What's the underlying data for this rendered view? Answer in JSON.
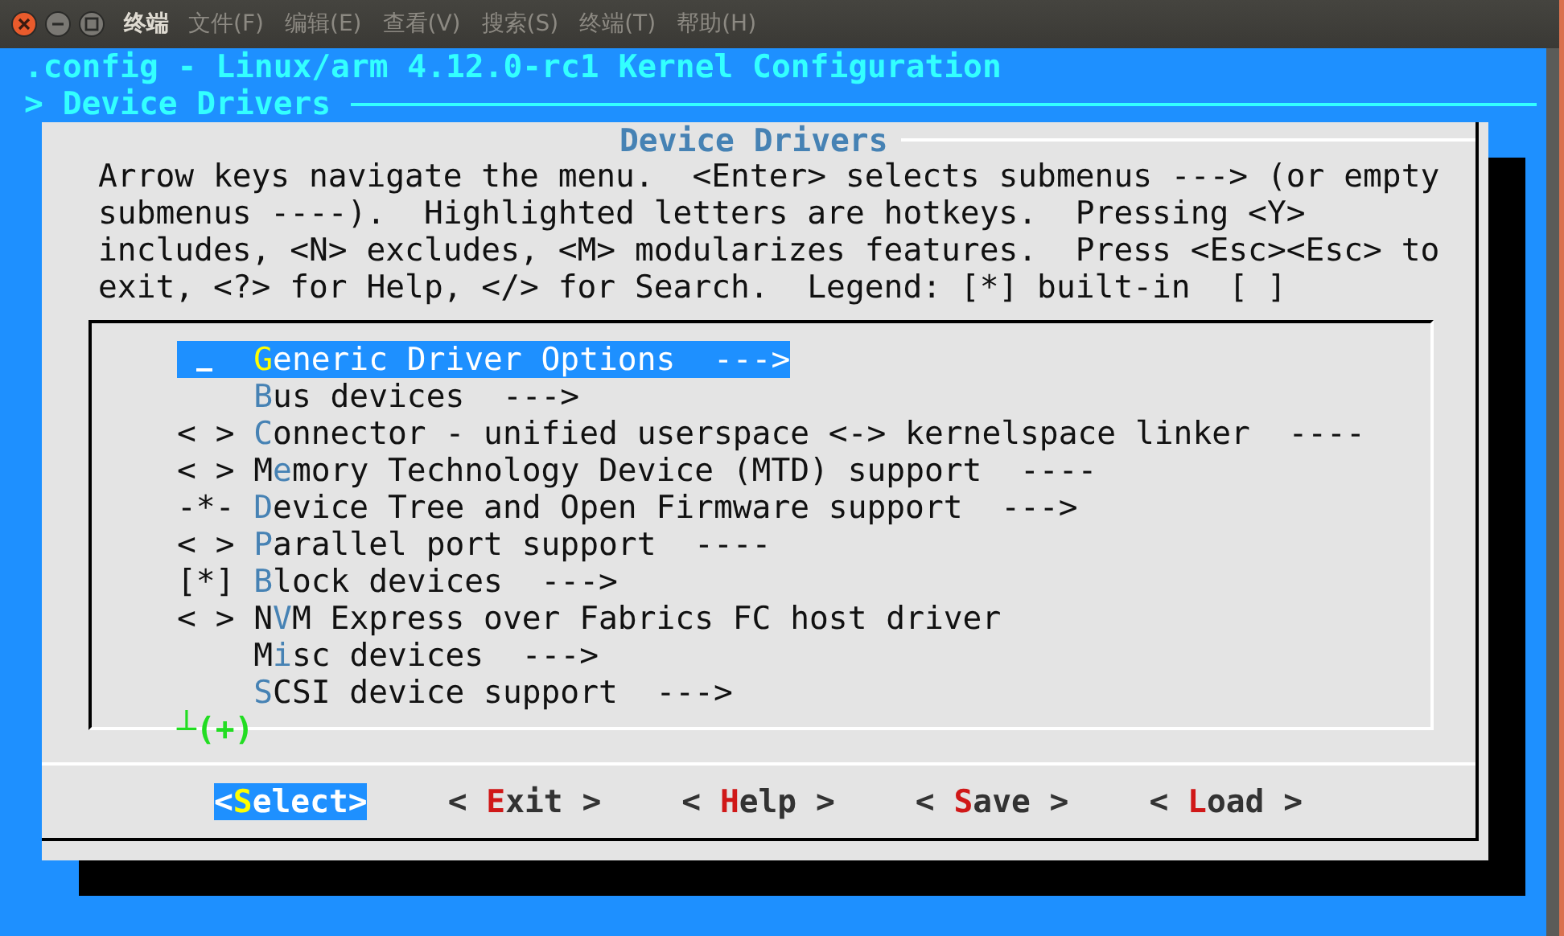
{
  "window": {
    "title": "终端",
    "menu": [
      "文件(F)",
      "编辑(E)",
      "查看(V)",
      "搜索(S)",
      "终端(T)",
      "帮助(H)"
    ]
  },
  "header": {
    "title": ".config - Linux/arm 4.12.0-rc1 Kernel Configuration",
    "breadcrumb": "> Device Drivers"
  },
  "dialog": {
    "title": "Device Drivers",
    "help_lines": [
      "Arrow keys navigate the menu.  <Enter> selects submenus ---> (or empty",
      "submenus ----).  Highlighted letters are hotkeys.  Pressing <Y>",
      "includes, <N> excludes, <M> modularizes features.  Press <Esc><Esc> to",
      "exit, <?> for Help, </> for Search.  Legend: [*] built-in  [ ]"
    ],
    "items": [
      {
        "hotkey": "G",
        "after": "eneric Driver Options  --->",
        "selected": true
      },
      {
        "hotkey": "B",
        "after": "us devices  --->",
        "selected": false
      },
      {
        "prefix": "< >",
        "hotkey": "C",
        "after": "onnector - unified userspace <-> kernelspace linker  ----",
        "selected": false
      },
      {
        "prefix": "< >",
        "before": "M",
        "hotkey": "e",
        "after": "mory Technology Device (MTD) support  ----",
        "selected": false
      },
      {
        "prefix": "-*-",
        "hotkey": "D",
        "after": "evice Tree and Open Firmware support  --->",
        "selected": false
      },
      {
        "prefix": "< >",
        "hotkey": "P",
        "after": "arallel port support  ----",
        "selected": false
      },
      {
        "prefix": "[*]",
        "hotkey": "B",
        "after": "lock devices  --->",
        "selected": false
      },
      {
        "prefix": "< >",
        "before": "N",
        "hotkey": "V",
        "after": "M Express over Fabrics FC host driver",
        "selected": false
      },
      {
        "before": "M",
        "hotkey": "i",
        "after": "sc devices  --->",
        "selected": false
      },
      {
        "hotkey": "S",
        "after": "CSI device support  --->",
        "selected": false
      }
    ],
    "more_indicator": "┴(+)",
    "buttons": [
      {
        "before": "<",
        "hotkey": "S",
        "after": "elect>",
        "selected": true
      },
      {
        "before": "< ",
        "hotkey": "E",
        "after": "xit >",
        "selected": false
      },
      {
        "before": "< ",
        "hotkey": "H",
        "after": "elp >",
        "selected": false
      },
      {
        "before": "< ",
        "hotkey": "S",
        "after": "ave >",
        "selected": false
      },
      {
        "before": "< ",
        "hotkey": "L",
        "after": "oad >",
        "selected": false
      }
    ]
  }
}
